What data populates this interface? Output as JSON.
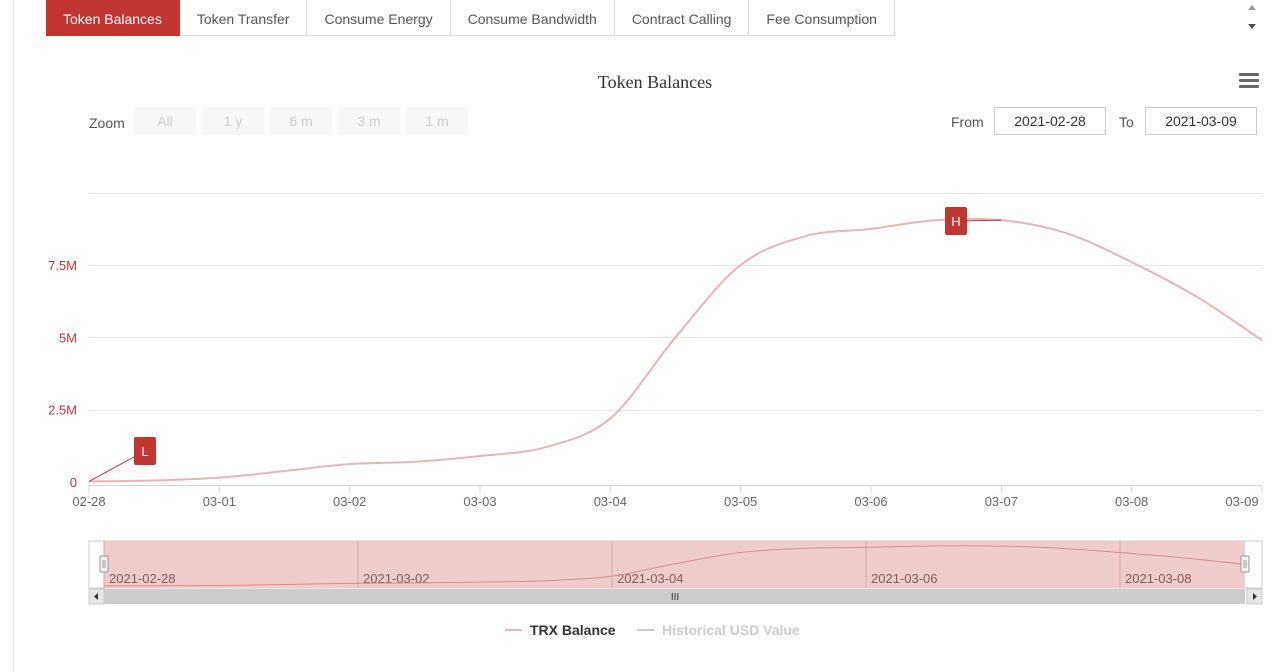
{
  "tabs": [
    {
      "label": "Token Balances",
      "active": true
    },
    {
      "label": "Token Transfer",
      "active": false
    },
    {
      "label": "Consume Energy",
      "active": false
    },
    {
      "label": "Consume Bandwidth",
      "active": false
    },
    {
      "label": "Contract Calling",
      "active": false
    },
    {
      "label": "Fee Consumption",
      "active": false
    }
  ],
  "zoom": {
    "label": "Zoom",
    "buttons": [
      "All",
      "1 y",
      "6 m",
      "3 m",
      "1 m"
    ]
  },
  "range": {
    "from_label": "From",
    "from_value": "2021-02-28",
    "to_label": "To",
    "to_value": "2021-03-09"
  },
  "colors": {
    "accent": "#c23631",
    "series_line": "#e8b4b4",
    "navigator_fill": "#edc6c6",
    "inactive_legend": "#cccccc"
  },
  "icons": {
    "menu": "hamburger-menu-icon",
    "scroll_up": "arrow-up-icon",
    "scroll_down": "arrow-down-icon"
  },
  "chart_data": {
    "type": "line",
    "title": "Token Balances",
    "x_unit": "date",
    "x_tick_labels": [
      "02-28",
      "03-01",
      "03-02",
      "03-03",
      "03-04",
      "03-05",
      "03-06",
      "03-07",
      "03-08",
      "03-09"
    ],
    "y_tick_labels": [
      "0",
      "2.5M",
      "5M",
      "7.5M"
    ],
    "y_tick_values": [
      0,
      2500000,
      5000000,
      7500000
    ],
    "ylim": [
      0,
      10000000
    ],
    "xlim": [
      "2021-02-28",
      "2021-03-09"
    ],
    "grid": true,
    "series": [
      {
        "name": "TRX Balance",
        "visible": true,
        "points": [
          [
            "2021-02-28 00:00",
            20000
          ],
          [
            "2021-02-28 12:00",
            50000
          ],
          [
            "2021-03-01 00:00",
            150000
          ],
          [
            "2021-03-01 12:00",
            380000
          ],
          [
            "2021-03-02 00:00",
            620000
          ],
          [
            "2021-03-02 12:00",
            700000
          ],
          [
            "2021-03-03 00:00",
            900000
          ],
          [
            "2021-03-03 12:00",
            1200000
          ],
          [
            "2021-03-04 00:00",
            2200000
          ],
          [
            "2021-03-04 12:00",
            5000000
          ],
          [
            "2021-03-05 00:00",
            7500000
          ],
          [
            "2021-03-05 12:00",
            8500000
          ],
          [
            "2021-03-06 00:00",
            8750000
          ],
          [
            "2021-03-06 12:00",
            9050000
          ],
          [
            "2021-03-07 00:00",
            9050000
          ],
          [
            "2021-03-07 12:00",
            8600000
          ],
          [
            "2021-03-08 00:00",
            7600000
          ],
          [
            "2021-03-08 12:00",
            6400000
          ],
          [
            "2021-03-09 00:00",
            4900000
          ]
        ]
      },
      {
        "name": "Historical USD Value",
        "visible": false,
        "points": []
      }
    ],
    "flags": [
      {
        "label": "L",
        "date": "2021-02-28 00:00",
        "value": 20000
      },
      {
        "label": "H",
        "date": "2021-03-07 00:00",
        "value": 9050000
      }
    ],
    "navigator": {
      "labels": [
        "2021-02-28",
        "2021-03-02",
        "2021-03-04",
        "2021-03-06",
        "2021-03-08"
      ],
      "scrollbar_grip": "III"
    },
    "legend_position": "bottom-center"
  }
}
